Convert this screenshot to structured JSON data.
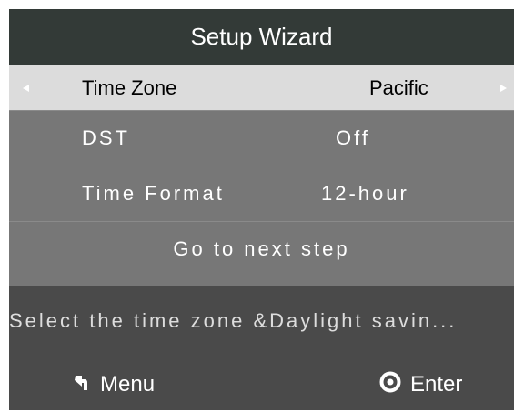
{
  "title": "Setup Wizard",
  "rows": [
    {
      "label": "Time Zone",
      "value": "Pacific"
    },
    {
      "label": "DST",
      "value": "Off"
    },
    {
      "label": "Time Format",
      "value": "12-hour"
    },
    {
      "label": "Go to next step"
    }
  ],
  "hint": "Select the time zone &Daylight savin...",
  "footer": {
    "menu_label": "Menu",
    "enter_label": "Enter"
  },
  "icons": {
    "menu": "back-arrow-icon",
    "enter": "circle-dot-icon"
  },
  "colors": {
    "title_bar": "#333a37",
    "rows_bg": "#777777",
    "selected_row": "#dcdcdc",
    "screen_bg": "#4a4a4a"
  }
}
